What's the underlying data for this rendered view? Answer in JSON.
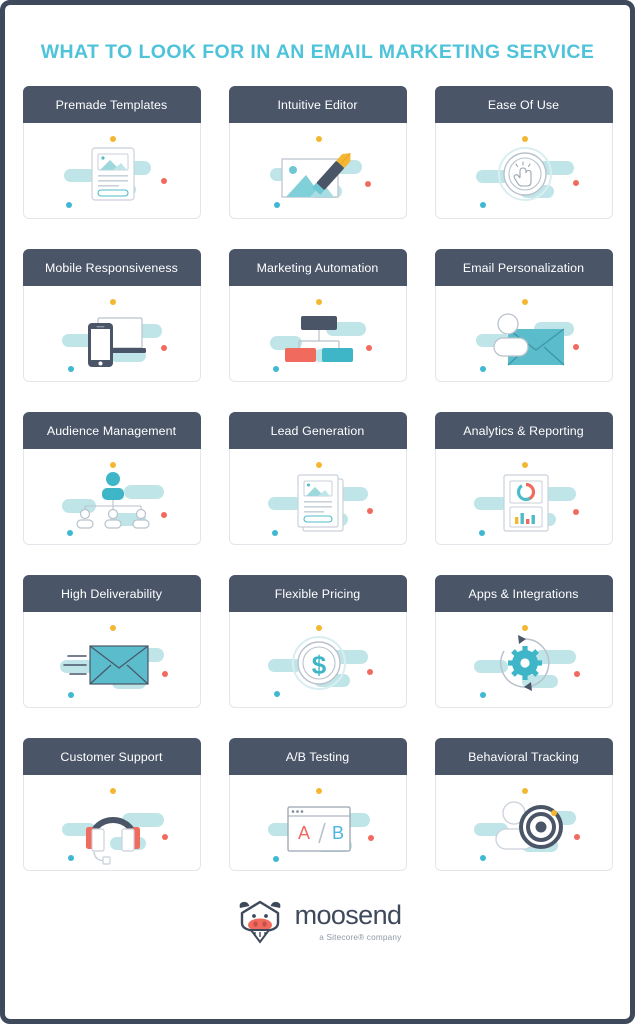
{
  "page": {
    "title": "WHAT TO LOOK FOR IN AN EMAIL MARKETING SERVICE",
    "background_color": "#ffffff",
    "border_color": "#3e4a5c",
    "title_color": "#4ec3d9"
  },
  "theme": {
    "header_bg": "#4a5568",
    "header_text": "#ffffff",
    "card_border": "#e2e6ea",
    "teal": "#4dbcc8",
    "teal_light": "#bfe5e8",
    "red": "#f06a5d",
    "yellow": "#f5b731",
    "cyan_dot": "#3fb8d4",
    "gray_line": "#c9d1d9",
    "dark": "#4a5568"
  },
  "accent_dots": {
    "top": "#f5b731",
    "right": "#f06a5d",
    "bottom_left": "#3fb8d4"
  },
  "cards": [
    {
      "label": "Premade Templates",
      "icon": "document-template-icon"
    },
    {
      "label": "Intuitive Editor",
      "icon": "pencil-image-edit-icon"
    },
    {
      "label": "Ease Of Use",
      "icon": "hand-click-circle-icon"
    },
    {
      "label": "Mobile Responsiveness",
      "icon": "phone-laptop-devices-icon"
    },
    {
      "label": "Marketing Automation",
      "icon": "flowchart-nodes-icon"
    },
    {
      "label": "Email Personalization",
      "icon": "person-envelope-icon"
    },
    {
      "label": "Audience Management",
      "icon": "org-chart-people-icon"
    },
    {
      "label": "Lead Generation",
      "icon": "stacked-documents-icon"
    },
    {
      "label": "Analytics & Reporting",
      "icon": "donut-bar-chart-report-icon"
    },
    {
      "label": "High Deliverability",
      "icon": "flying-envelope-icon"
    },
    {
      "label": "Flexible Pricing",
      "icon": "dollar-coin-icon"
    },
    {
      "label": "Apps & Integrations",
      "icon": "gear-refresh-icon"
    },
    {
      "label": "Customer Support",
      "icon": "headset-icon"
    },
    {
      "label": "A/B Testing",
      "icon": "browser-ab-split-icon"
    },
    {
      "label": "Behavioral Tracking",
      "icon": "target-person-icon"
    }
  ],
  "footer": {
    "logo_icon": "moosend-cow-logo",
    "brand": "moosend",
    "tagline": "a Sitecore® company"
  }
}
